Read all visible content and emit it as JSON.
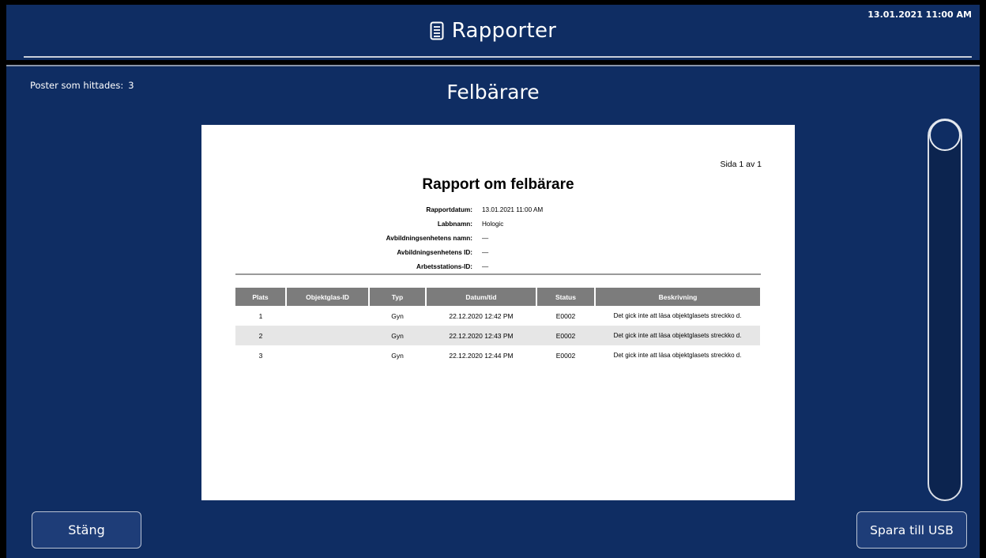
{
  "header": {
    "title": "Rapporter",
    "title_icon": "document-icon",
    "datetime": "13.01.2021 11:00 AM"
  },
  "main": {
    "records_label": "Poster som hittades:",
    "records_count": "3",
    "heading": "Felbärare"
  },
  "report": {
    "page_indicator": "Sida 1 av 1",
    "title": "Rapport om felbärare",
    "meta": [
      {
        "label": "Rapportdatum:",
        "value": "13.01.2021 11:00 AM"
      },
      {
        "label": "Labbnamn:",
        "value": "Hologic"
      },
      {
        "label": "Avbildningsenhetens namn:",
        "value": "—"
      },
      {
        "label": "Avbildningsenhetens ID:",
        "value": "—"
      },
      {
        "label": "Arbetsstations-ID:",
        "value": "—"
      }
    ],
    "columns": [
      "Plats",
      "Objektglas-ID",
      "Typ",
      "Datum/tid",
      "Status",
      "Beskrivning"
    ],
    "rows": [
      [
        "1",
        "",
        "Gyn",
        "22.12.2020 12:42 PM",
        "E0002",
        "Det gick inte att läsa objektglasets streckko d."
      ],
      [
        "2",
        "",
        "Gyn",
        "22.12.2020 12:43 PM",
        "E0002",
        "Det gick inte att läsa objektglasets streckko d."
      ],
      [
        "3",
        "",
        "Gyn",
        "22.12.2020 12:44 PM",
        "E0002",
        "Det gick inte att läsa objektglasets streckko d."
      ]
    ]
  },
  "buttons": {
    "close": "Stäng",
    "save_usb": "Spara till USB"
  },
  "colors": {
    "background": "#0f2d63",
    "table_header": "#7c7c7c",
    "alt_row": "#e6e6e6"
  }
}
